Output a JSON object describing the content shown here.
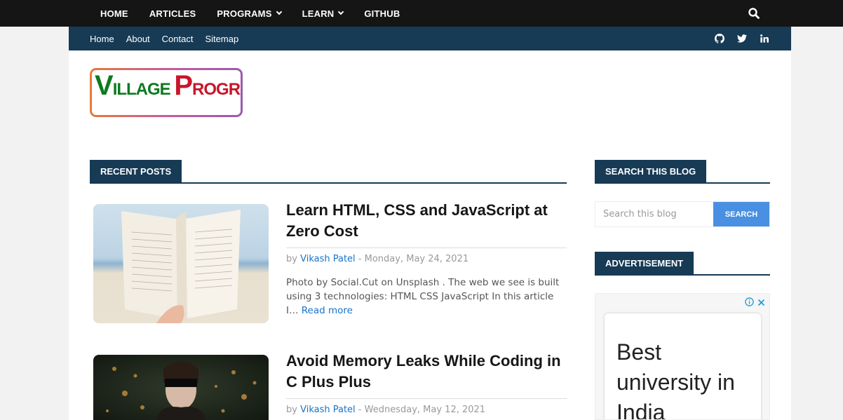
{
  "topnav": {
    "home": "HOME",
    "articles": "ARTICLES",
    "programs": "PROGRAMS",
    "learn": "LEARN",
    "github": "GITHUB"
  },
  "subnav": {
    "home": "Home",
    "about": "About",
    "contact": "Contact",
    "sitemap": "Sitemap"
  },
  "logo": {
    "p1": "V",
    "p2": "ILLAGE ",
    "p3": "P",
    "p4": "ROGRAMMER"
  },
  "sections": {
    "recent_posts": "RECENT POSTS",
    "search_blog": "SEARCH THIS BLOG",
    "advertisement": "ADVERTISEMENT"
  },
  "posts": [
    {
      "title": "Learn HTML, CSS and JavaScript at Zero Cost",
      "by": "by",
      "author": "Vikash Patel",
      "sep": "-",
      "date": "Monday, May 24, 2021",
      "excerpt": "Photo by Social.Cut on Unsplash . The web we see is built using 3 technologies: HTML CSS JavaScript In this article I…",
      "read_more": "Read more"
    },
    {
      "title": "Avoid Memory Leaks While Coding in C Plus Plus",
      "by": "by",
      "author": "Vikash Patel",
      "sep": "-",
      "date": "Wednesday, May 12, 2021"
    }
  ],
  "search": {
    "placeholder": "Search this blog",
    "button": "SEARCH"
  },
  "ad": {
    "headline": "Best university in India"
  },
  "colors": {
    "topbar": "#151515",
    "subbar": "#173a55",
    "link": "#1a73c8",
    "search_button": "#4a90e2"
  }
}
